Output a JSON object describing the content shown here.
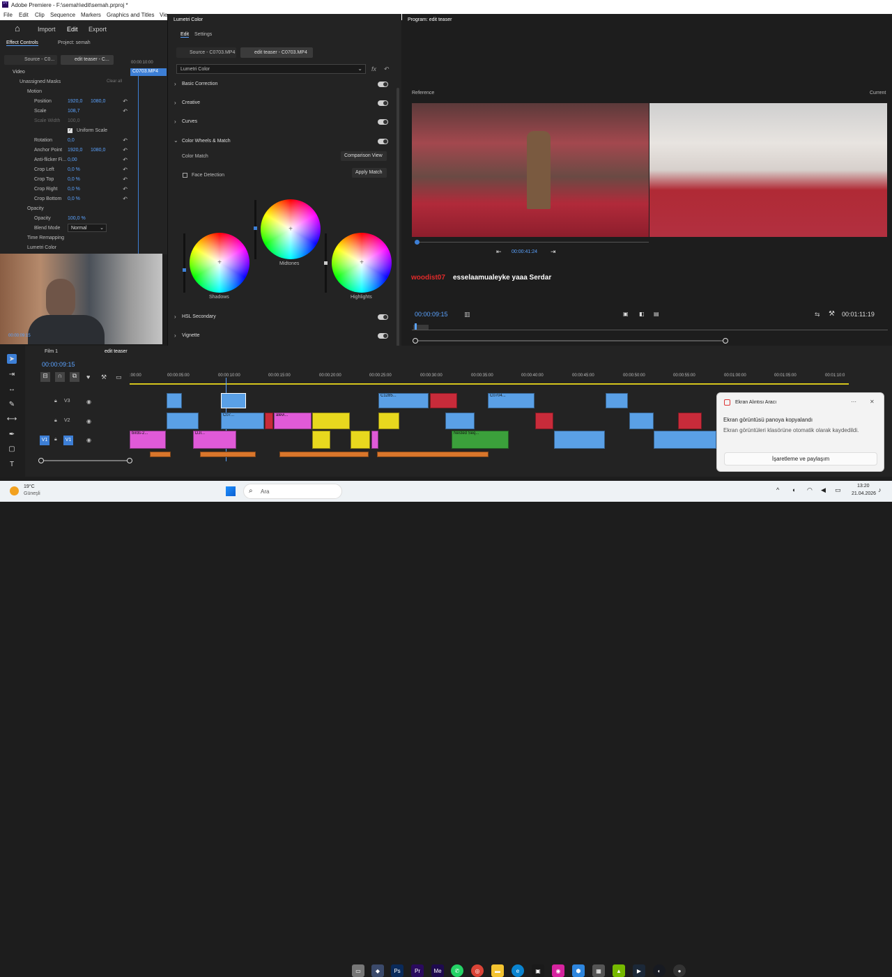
{
  "app": {
    "title": "Adobe Premiere - F:\\semah\\edit\\semah.prproj *",
    "menu": [
      "File",
      "Edit",
      "Clip",
      "Sequence",
      "Markers",
      "Graphics and Titles",
      "Vie"
    ]
  },
  "workspace": {
    "home": "⌂",
    "import": "Import",
    "edit": "Edit",
    "export": "Export"
  },
  "effect_controls": {
    "tab": "Effect Controls",
    "project": "Project: semah",
    "source_clip": "Source - C0...",
    "seq_clip": "edit teaser - C...",
    "timecode": "00:00:10:00",
    "clip_name": "C0703.MP4",
    "video": "Video",
    "masks": "Unassigned Masks",
    "clear": "Clear all",
    "motion": "Motion",
    "rows": [
      {
        "label": "Position",
        "v1": "1920,0",
        "v2": "1080,0"
      },
      {
        "label": "Scale",
        "v1": "108,7",
        "v2": ""
      },
      {
        "label": "Scale Width",
        "v1": "100,0",
        "v2": ""
      },
      {
        "label": "Uniform Scale",
        "v1": "",
        "v2": ""
      },
      {
        "label": "Rotation",
        "v1": "0,0",
        "v2": ""
      },
      {
        "label": "Anchor Point",
        "v1": "1920,0",
        "v2": "1080,0"
      },
      {
        "label": "Anti-flicker Fi...",
        "v1": "0,00",
        "v2": ""
      },
      {
        "label": "Crop Left",
        "v1": "0,0 %",
        "v2": ""
      },
      {
        "label": "Crop Top",
        "v1": "0,0 %",
        "v2": ""
      },
      {
        "label": "Crop Right",
        "v1": "0,0 %",
        "v2": ""
      },
      {
        "label": "Crop Bottom",
        "v1": "0,0 %",
        "v2": ""
      }
    ],
    "opacity": "Opacity",
    "opacity_val": "100,0 %",
    "blend": "Blend Mode",
    "blend_val": "Normal",
    "time_remap": "Time Remapping",
    "lumetri": "Lumetri Color",
    "webcam_tc": "00:00:09:15"
  },
  "lumetri": {
    "title": "Lumetri Color",
    "tab_edit": "Edit",
    "tab_settings": "Settings",
    "source": "Source - C0703.MP4",
    "seq": "edit teaser - C0703.MP4",
    "effect": "Lumetri Color",
    "basic": "Basic Correction",
    "creative": "Creative",
    "curves": "Curves",
    "cwm": "Color Wheels & Match",
    "color_match": "Color Match",
    "comparison": "Comparison View",
    "face": "Face Detection",
    "apply": "Apply Match",
    "shadows": "Shadows",
    "midtones": "Midtones",
    "highlights": "Highlights",
    "hsl": "HSL Secondary",
    "vignette": "Vignette"
  },
  "program": {
    "title": "Program: edit teaser",
    "reference": "Reference",
    "current": "Current",
    "ref_tc": "00:00:41:24",
    "chat_user": "woodist07",
    "chat_msg": "esselaamualeyke yaaa Serdar",
    "tc": "00:00:09:15",
    "duration": "00:01:11:19"
  },
  "timeline": {
    "tab1": "Film 1",
    "tab2": "edit teaser",
    "tc": "00:00:09:15",
    "ruler": [
      ":00:00",
      "00:00:05:00",
      "00:00:10:00",
      "00:00:15:00",
      "00:00:20:00",
      "00:00:25:00",
      "00:00:30:00",
      "00:00:35:00",
      "00:00:40:00",
      "00:00:45:00",
      "00:00:50:00",
      "00:00:55:00",
      "00:01:00:00",
      "00:01:05:00",
      "00:01:10:0"
    ],
    "tracks": [
      "V3",
      "V2",
      "V1"
    ],
    "clip_labels": [
      "C1285...",
      "C0704...",
      "C07...",
      "alevi...",
      "birds-2...",
      "DJI...",
      "Nested Seq..."
    ]
  },
  "toast": {
    "app": "Ekran Alıntısı Aracı",
    "title": "Ekran görüntüsü panoya kopyalandı",
    "body": "Ekran görüntüleri klasörüne otomatik olarak kaydedildi.",
    "button": "İşaretleme ve paylaşım"
  },
  "taskbar": {
    "temp": "19°C",
    "weather": "Güneşli",
    "search": "Ara",
    "time": "13:20",
    "date": "21.04.2026"
  }
}
